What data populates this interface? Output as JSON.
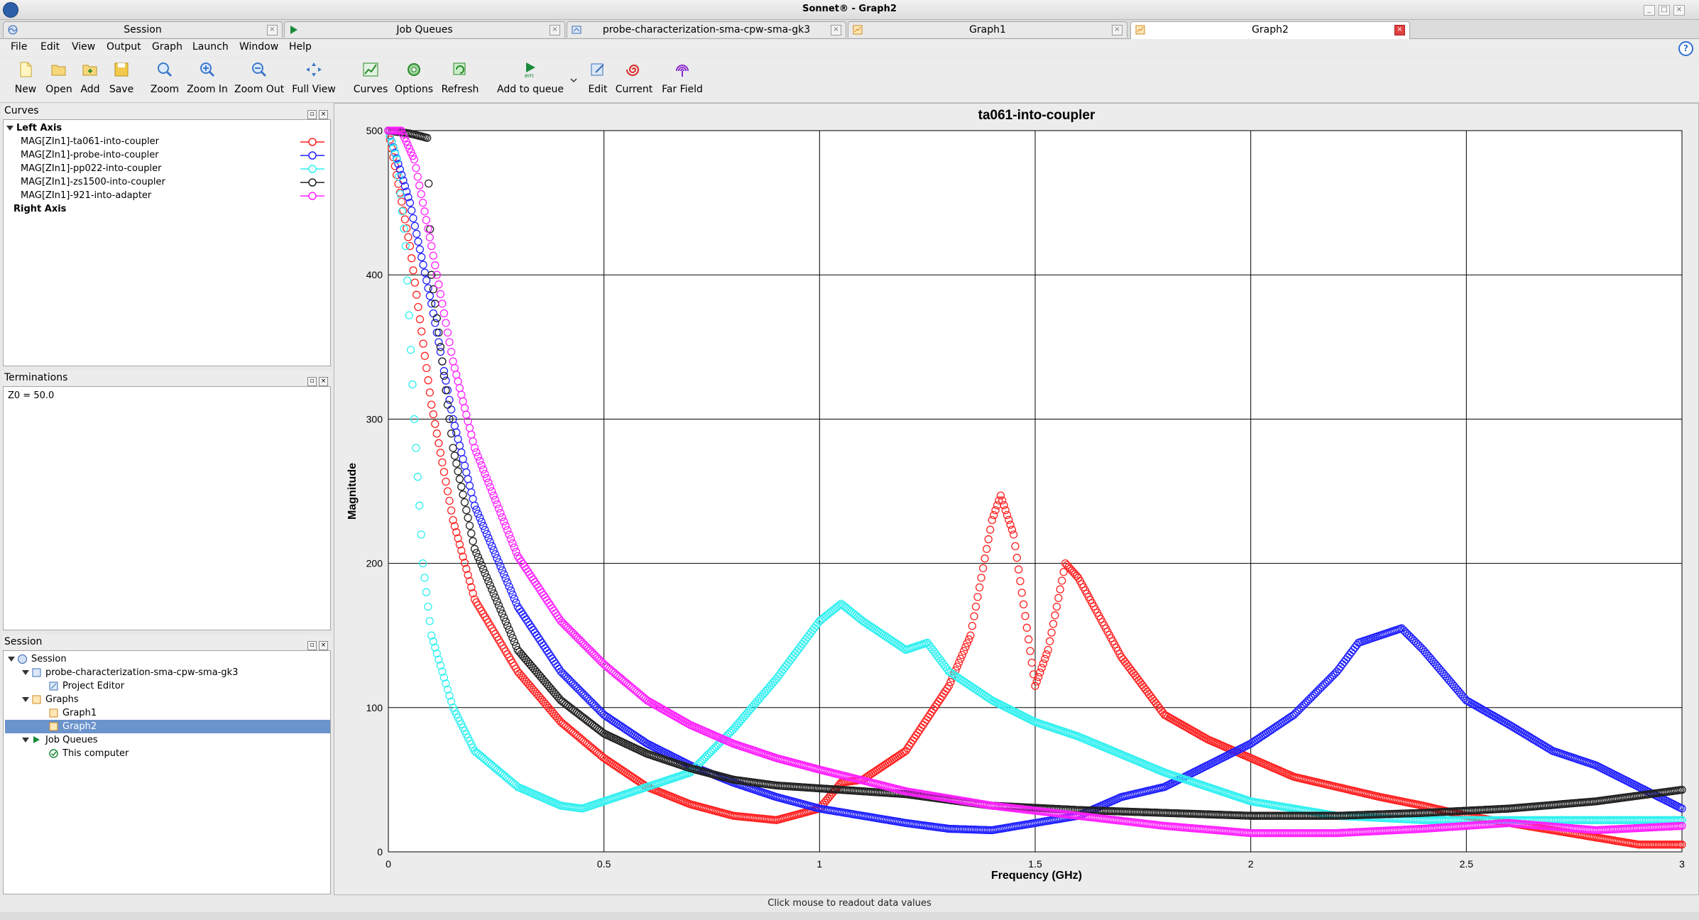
{
  "window": {
    "title": "Sonnet® - Graph2"
  },
  "tabs": [
    {
      "label": "Session",
      "icon": "session-icon"
    },
    {
      "label": "Job Queues",
      "icon": "em-icon"
    },
    {
      "label": "probe-characterization-sma-cpw-sma-gk3",
      "icon": "project-icon"
    },
    {
      "label": "Graph1",
      "icon": "graph-icon"
    },
    {
      "label": "Graph2",
      "icon": "graph-icon",
      "active": true
    }
  ],
  "menu": [
    "File",
    "Edit",
    "View",
    "Output",
    "Graph",
    "Launch",
    "Window",
    "Help"
  ],
  "toolbar": {
    "new": "New",
    "open": "Open",
    "add": "Add",
    "save": "Save",
    "zoom": "Zoom",
    "zoom_in": "Zoom In",
    "zoom_out": "Zoom Out",
    "full_view": "Full View",
    "curves": "Curves",
    "options": "Options",
    "refresh": "Refresh",
    "add_to_queue": "Add to queue",
    "edit": "Edit",
    "current": "Current",
    "far_field": "Far Field"
  },
  "curves_panel": {
    "title": "Curves",
    "left_axis": "Left Axis",
    "right_axis": "Right Axis",
    "items": [
      {
        "label": "MAG[ZIn1]-ta061-into-coupler",
        "color": "#ff2020"
      },
      {
        "label": "MAG[ZIn1]-probe-into-coupler",
        "color": "#2020ff"
      },
      {
        "label": "MAG[ZIn1]-pp022-into-coupler",
        "color": "#30f0f0"
      },
      {
        "label": "MAG[ZIn1]-zs1500-into-coupler",
        "color": "#202020"
      },
      {
        "label": "MAG[ZIn1]-921-into-adapter",
        "color": "#ff20ff"
      }
    ]
  },
  "terminations_panel": {
    "title": "Terminations",
    "value": "Z0 = 50.0"
  },
  "session_panel": {
    "title": "Session",
    "root": "Session",
    "project": "probe-characterization-sma-cpw-sma-gk3",
    "project_editor": "Project Editor",
    "graphs": "Graphs",
    "graph1": "Graph1",
    "graph2": "Graph2",
    "job_queues": "Job Queues",
    "this_computer": "This computer"
  },
  "status": "Click mouse to readout data values",
  "chart_data": {
    "type": "scatter",
    "title": "ta061-into-coupler",
    "xlabel": "Frequency (GHz)",
    "ylabel": "Magnitude",
    "xlim": [
      0,
      3
    ],
    "ylim": [
      0,
      500
    ],
    "xticks": [
      "0",
      "0.5",
      "1",
      "1.5",
      "2",
      "2.5",
      "3"
    ],
    "yticks": [
      "0",
      "100",
      "200",
      "300",
      "400",
      "500"
    ],
    "grid": true,
    "marker": "open-circle",
    "series": [
      {
        "name": "MAG[ZIn1]-ta061-into-coupler",
        "color": "#ff2020",
        "x": [
          0,
          0.05,
          0.1,
          0.15,
          0.2,
          0.3,
          0.4,
          0.5,
          0.6,
          0.7,
          0.8,
          0.9,
          1.0,
          1.05,
          1.1,
          1.2,
          1.3,
          1.35,
          1.4,
          1.42,
          1.45,
          1.5,
          1.53,
          1.57,
          1.6,
          1.7,
          1.8,
          1.9,
          2.0,
          2.1,
          2.2,
          2.3,
          2.4,
          2.5,
          2.6,
          2.7,
          2.8,
          2.9,
          3.0
        ],
        "y": [
          500,
          420,
          310,
          230,
          175,
          125,
          90,
          65,
          45,
          33,
          25,
          22,
          30,
          48,
          50,
          70,
          115,
          150,
          230,
          247,
          220,
          115,
          140,
          200,
          190,
          135,
          95,
          78,
          65,
          52,
          45,
          38,
          32,
          25,
          20,
          15,
          10,
          5,
          5
        ]
      },
      {
        "name": "MAG[ZIn1]-probe-into-coupler",
        "color": "#2020ff",
        "x": [
          0,
          0.05,
          0.1,
          0.15,
          0.2,
          0.3,
          0.4,
          0.5,
          0.6,
          0.7,
          0.8,
          0.9,
          1.0,
          1.1,
          1.2,
          1.3,
          1.4,
          1.5,
          1.6,
          1.7,
          1.8,
          1.9,
          2.0,
          2.1,
          2.2,
          2.25,
          2.3,
          2.35,
          2.4,
          2.5,
          2.6,
          2.7,
          2.8,
          2.9,
          3.0
        ],
        "y": [
          500,
          450,
          380,
          300,
          240,
          170,
          125,
          95,
          75,
          60,
          48,
          38,
          30,
          25,
          20,
          16,
          15,
          20,
          25,
          38,
          45,
          60,
          75,
          95,
          125,
          145,
          150,
          155,
          140,
          105,
          88,
          70,
          60,
          45,
          30
        ]
      },
      {
        "name": "MAG[ZIn1]-pp022-into-coupler",
        "color": "#30f0f0",
        "x": [
          0,
          0.02,
          0.04,
          0.06,
          0.08,
          0.1,
          0.15,
          0.2,
          0.3,
          0.4,
          0.45,
          0.5,
          0.6,
          0.7,
          0.8,
          0.9,
          1.0,
          1.05,
          1.1,
          1.2,
          1.25,
          1.3,
          1.4,
          1.5,
          1.6,
          1.8,
          2.0,
          2.2,
          2.4,
          2.6,
          2.8,
          3.0
        ],
        "y": [
          500,
          480,
          420,
          300,
          200,
          150,
          100,
          70,
          45,
          32,
          30,
          35,
          45,
          55,
          85,
          120,
          160,
          172,
          160,
          140,
          145,
          125,
          105,
          90,
          80,
          55,
          35,
          25,
          22,
          22,
          22,
          22
        ]
      },
      {
        "name": "MAG[ZIn1]-zs1500-into-coupler",
        "color": "#202020",
        "x": [
          0,
          0.05,
          0.09,
          0.1,
          0.15,
          0.2,
          0.3,
          0.4,
          0.5,
          0.6,
          0.7,
          0.8,
          0.9,
          1.0,
          1.2,
          1.4,
          1.6,
          1.8,
          2.0,
          2.2,
          2.4,
          2.6,
          2.8,
          3.0
        ],
        "y": [
          500,
          498,
          495,
          400,
          280,
          210,
          140,
          105,
          82,
          68,
          58,
          50,
          46,
          44,
          40,
          32,
          29,
          27,
          25,
          25,
          27,
          30,
          35,
          43
        ]
      },
      {
        "name": "MAG[ZIn1]-921-into-adapter",
        "color": "#ff20ff",
        "x": [
          0,
          0.03,
          0.06,
          0.1,
          0.15,
          0.2,
          0.3,
          0.4,
          0.5,
          0.6,
          0.7,
          0.8,
          0.9,
          1.0,
          1.2,
          1.4,
          1.6,
          1.8,
          2.0,
          2.2,
          2.4,
          2.6,
          2.8,
          3.0
        ],
        "y": [
          500,
          500,
          480,
          420,
          340,
          280,
          205,
          160,
          130,
          105,
          88,
          75,
          65,
          57,
          42,
          32,
          25,
          18,
          13,
          13,
          16,
          20,
          15,
          18
        ]
      }
    ]
  }
}
